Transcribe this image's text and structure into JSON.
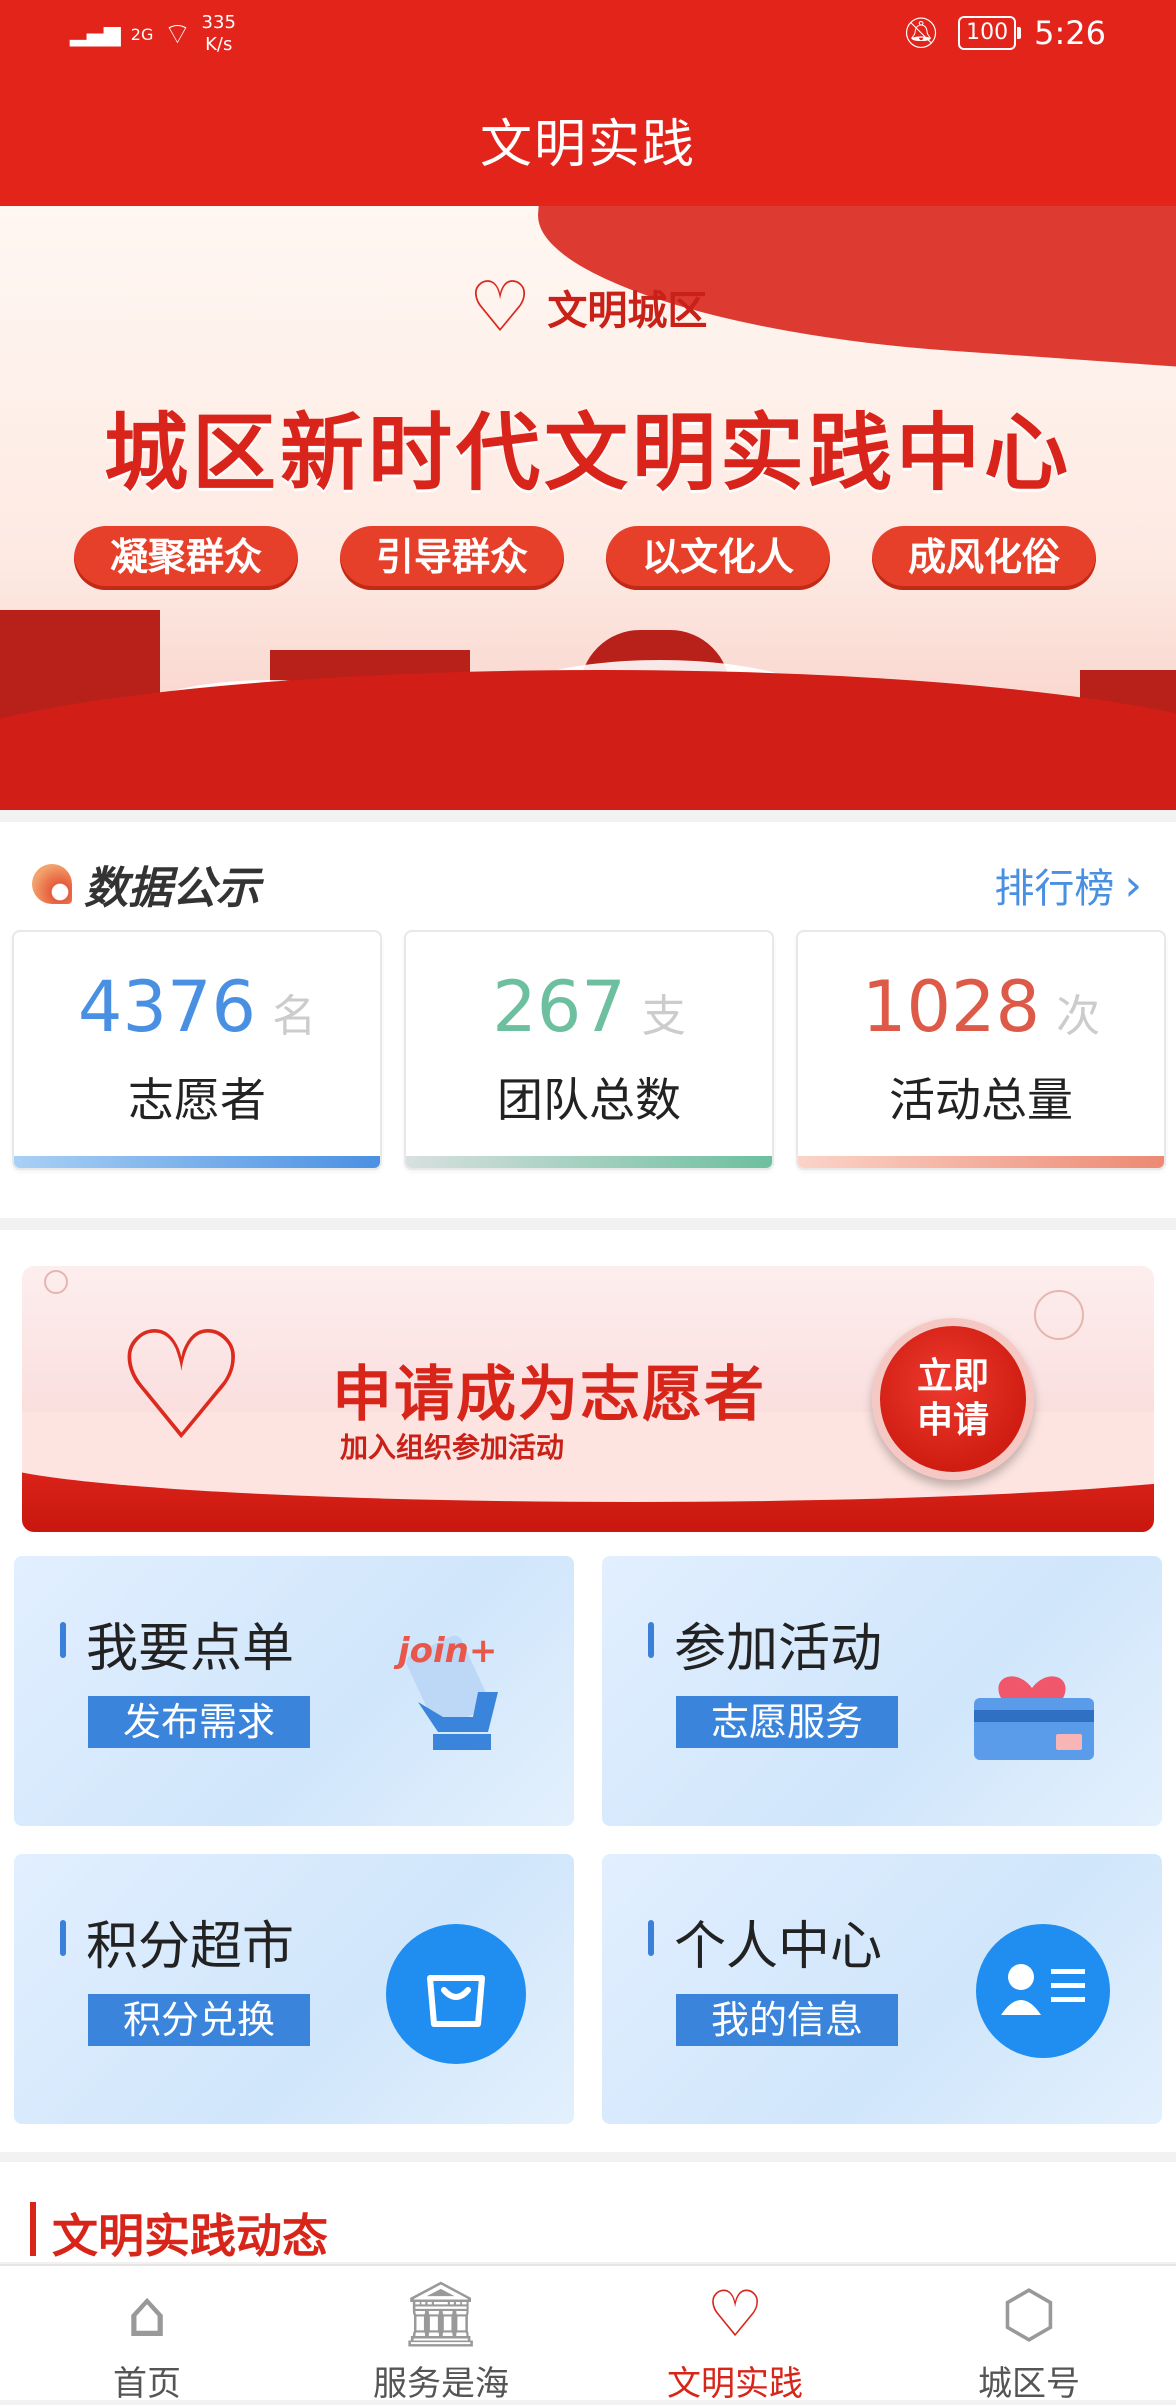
{
  "status_bar": {
    "signal": "2G",
    "net_speed_value": "335",
    "net_speed_unit": "K/s",
    "battery": "100",
    "time": "5:26"
  },
  "header": {
    "title": "文明实践"
  },
  "banner": {
    "logo_text": "文明城区",
    "title": "城区新时代文明实践中心",
    "pills": [
      "凝聚群众",
      "引导群众",
      "以文化人",
      "成风化俗"
    ]
  },
  "data_section": {
    "title": "数据公示",
    "rank_link": "排行榜",
    "cards": [
      {
        "value": "4376",
        "unit": "名",
        "label": "志愿者",
        "color": "#4a90e2",
        "bar": "#4a90e2"
      },
      {
        "value": "267",
        "unit": "支",
        "label": "团队总数",
        "color": "#5fb89c",
        "bar": "#6cbf9f"
      },
      {
        "value": "1028",
        "unit": "次",
        "label": "活动总量",
        "color": "#dd5a48",
        "bar": "#ec8a73"
      }
    ]
  },
  "apply_banner": {
    "title": "申请成为志愿者",
    "subtitle": "加入组织参加活动",
    "button_line1": "立即",
    "button_line2": "申请"
  },
  "features": [
    {
      "title": "我要点单",
      "button": "发布需求",
      "icon": "join-hand-icon"
    },
    {
      "title": "参加活动",
      "button": "志愿服务",
      "icon": "heart-card-icon"
    },
    {
      "title": "积分超市",
      "button": "积分兑换",
      "icon": "shopping-bag-icon"
    },
    {
      "title": "个人中心",
      "button": "我的信息",
      "icon": "profile-card-icon"
    }
  ],
  "news": {
    "title": "文明实践动态"
  },
  "bottom_nav": [
    {
      "label": "首页",
      "icon": "home-icon",
      "active": false
    },
    {
      "label": "服务是海",
      "icon": "bank-icon",
      "active": false
    },
    {
      "label": "文明实践",
      "icon": "heart-hands-icon",
      "active": true
    },
    {
      "label": "城区号",
      "icon": "cube-icon",
      "active": false
    }
  ],
  "colors": {
    "primary_red": "#e3241b",
    "accent_blue": "#3a84dc"
  }
}
